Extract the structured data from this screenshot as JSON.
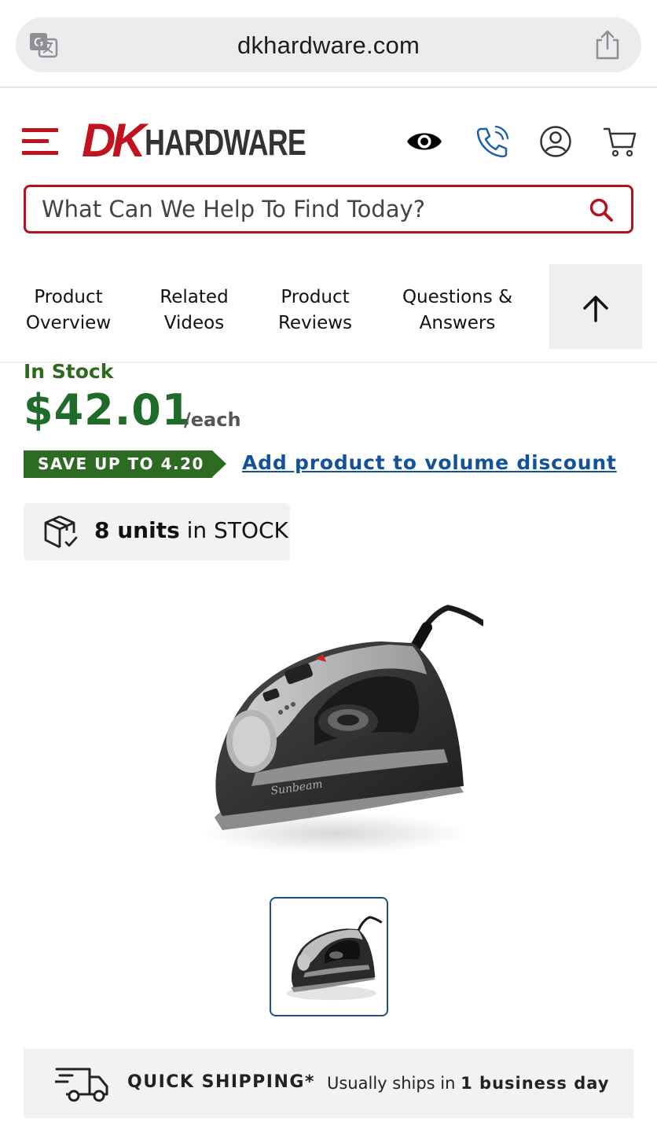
{
  "browser": {
    "url": "dkhardware.com",
    "icons": [
      "translate-icon",
      "share-icon"
    ]
  },
  "header": {
    "logo_dk": "DK",
    "logo_hardware": "HARDWARE",
    "icons": [
      "menu-icon",
      "eye-icon",
      "phone-icon",
      "account-icon",
      "cart-icon"
    ],
    "brand_color": "#c1121f"
  },
  "search": {
    "placeholder": "What Can We Help To Find Today?",
    "value": ""
  },
  "tabs": [
    {
      "line1": "Product",
      "line2": "Overview"
    },
    {
      "line1": "Related",
      "line2": "Videos"
    },
    {
      "line1": "Product",
      "line2": "Reviews"
    },
    {
      "line1": "Questions &",
      "line2": "Answers"
    }
  ],
  "product": {
    "stock_status": "In Stock",
    "price": "$42.01",
    "per_unit": "/each",
    "save_badge": "SAVE UP TO 4.20",
    "discount_link": "Add product to volume discount",
    "units_count": "8 units",
    "units_suffix": " in STOCK",
    "price_color": "#1f6b2a",
    "link_color": "#11529b"
  },
  "shipping": {
    "title": "QUICK SHIPPING*",
    "text_prefix": "Usually ships in ",
    "text_bold": "1 business day"
  }
}
